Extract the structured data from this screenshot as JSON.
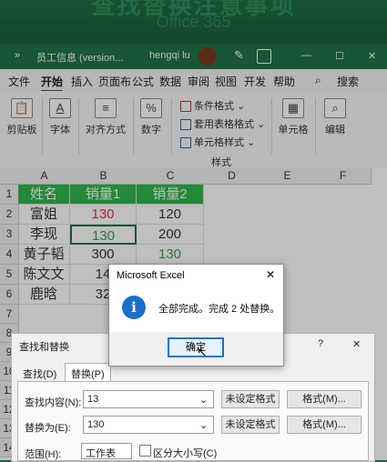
{
  "banner": {
    "title": "查找替换注意事项",
    "subtitle": "Office 365"
  },
  "titlebar": {
    "overflow": "»",
    "file_name": "员工信息 (version...",
    "user": "hengqi lu",
    "minimize": "—",
    "maximize": "☐",
    "close": "✕"
  },
  "tabs": [
    "文件",
    "开始",
    "插入",
    "页面布",
    "公式",
    "数据",
    "审阅",
    "视图",
    "开发",
    "帮助"
  ],
  "search_label": "搜索",
  "ribbon": {
    "clipboard": "剪贴板",
    "font": "字体",
    "alignment": "对齐方式",
    "number": "数字",
    "cond_format": "条件格式 ⌄",
    "table_format": "套用表格格式 ⌄",
    "cell_style": "单元格样式 ⌄",
    "styles_group": "样式",
    "cells": "单元格",
    "editing": "编辑"
  },
  "columns": [
    "A",
    "B",
    "C",
    "D",
    "E",
    "F"
  ],
  "rows": [
    "1",
    "2",
    "3",
    "4",
    "5",
    "6",
    "7",
    "8",
    "9",
    "10",
    "11",
    "12",
    "13",
    "14",
    "15",
    "16"
  ],
  "table": {
    "header": [
      "姓名",
      "销量1",
      "销量2"
    ],
    "data": [
      [
        "富姐",
        "130",
        "120"
      ],
      [
        "李现",
        "130",
        "200"
      ],
      [
        "黄子韬",
        "300",
        "130"
      ],
      [
        "陈文文",
        "14",
        ""
      ],
      [
        "鹿晗",
        "32",
        ""
      ]
    ]
  },
  "msgbox": {
    "title": "Microsoft Excel",
    "close": "✕",
    "info_glyph": "i",
    "message": "全部完成。完成 2 处替换。",
    "ok": "确定"
  },
  "find_replace": {
    "title": "查找和替换",
    "help": "?",
    "close": "✕",
    "tab_find": "查找(D)",
    "tab_replace": "替换(P)",
    "find_label": "查找内容(N):",
    "find_value": "13",
    "replace_label": "替换为(E):",
    "replace_value": "130",
    "no_format": "未设定格式",
    "format_btn": "格式(M)...",
    "scope_label": "范围(H):",
    "scope_value": "工作表",
    "match_case": "区分大小写(C)"
  },
  "colors": {
    "accent_green": "#217346",
    "header_fill": "#2eb84b",
    "red_text": "#d83b3b",
    "green_text": "#2e9e4a"
  }
}
